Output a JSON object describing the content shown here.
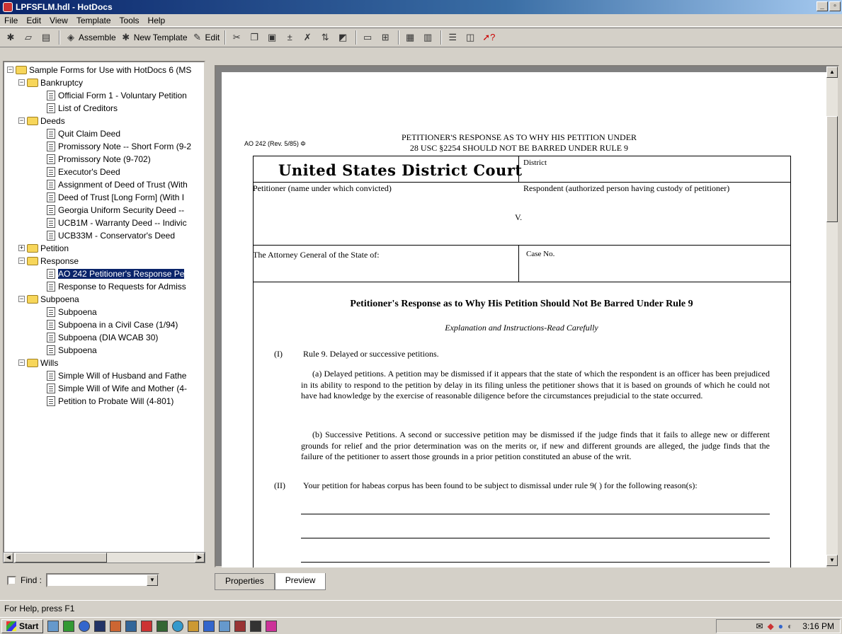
{
  "window": {
    "title": "LPFSFLM.hdl - HotDocs"
  },
  "menu": [
    "File",
    "Edit",
    "View",
    "Template",
    "Tools",
    "Help"
  ],
  "toolbar": {
    "assemble": "Assemble",
    "new_template": "New Template",
    "edit": "Edit"
  },
  "tree": {
    "root": "Sample Forms for Use with HotDocs 6 (MS",
    "bankruptcy": "Bankruptcy",
    "bk1": "Official Form 1 - Voluntary Petition",
    "bk2": "List of Creditors",
    "deeds": "Deeds",
    "d1": "Quit Claim Deed",
    "d2": "Promissory Note -- Short Form (9-2",
    "d3": "Promissory Note (9-702)",
    "d4": "Executor's Deed",
    "d5": "Assignment of Deed of Trust (With",
    "d6": "Deed of Trust [Long Form] (With I",
    "d7": "Georgia Uniform Security Deed --",
    "d8": "UCB1M - Warranty Deed -- Indivic",
    "d9": "UCB33M - Conservator's Deed",
    "petition": "Petition",
    "response": "Response",
    "r1": "AO 242 Petitioner's Response Pe",
    "r2": "Response to Requests for Admiss",
    "subpoena": "Subpoena",
    "s1": "Subpoena",
    "s2": "Subpoena in a Civil Case (1/94)",
    "s3": "Subpoena (DIA WCAB 30)",
    "s4": "Subpoena",
    "wills": "Wills",
    "w1": "Simple Will of Husband and Fathe",
    "w2": "Simple Will of Wife and Mother (4-",
    "w3": "Petition to Probate Will (4-801)"
  },
  "find": {
    "label": "Find :"
  },
  "tabs": {
    "properties": "Properties",
    "preview": "Preview"
  },
  "status": "For Help, press F1",
  "taskbar": {
    "start": "Start",
    "clock": "3:16 PM"
  },
  "doc": {
    "form_id": "AO 242 (Rev. 5/85)",
    "form_mark": "Φ",
    "header1": "PETITIONER'S RESPONSE AS TO WHY HIS PETITION UNDER",
    "header2": "28 USC §2254 SHOULD NOT BE BARRED UNDER RULE 9",
    "court": "United States District Court",
    "district": "District",
    "petitioner": "Petitioner (name under which convicted)",
    "respondent": "Respondent (authorized person having custody of petitioner)",
    "v": "V.",
    "attorney": "The Attorney General of the State of:",
    "case_no": "Case No.",
    "title": "Petitioner's Response as to Why His Petition Should Not Be Barred Under Rule 9",
    "subtitle": "Explanation and Instructions-Read Carefully",
    "i_num": "(I)",
    "i_text": "Rule 9. Delayed or successive petitions.",
    "para_a": "(a) Delayed petitions. A petition may be dismissed if it appears that the state of which the respondent is an officer has been prejudiced in its ability to respond to the petition by delay in its filing unless the petitioner shows that it is based on grounds of which he could not have had knowledge by the exercise of reasonable diligence before the circumstances prejudicial to the state occurred.",
    "para_b": "(b) Successive Petitions. A second or successive petition may be dismissed if the judge finds that it fails to allege new or different grounds for relief and the prior determination was on the merits or, if new and different grounds are alleged, the judge finds that the failure of the petitioner to assert those grounds in a prior petition constituted an abuse of the writ.",
    "ii_num": "(II)",
    "ii_text": "Your petition for habeas corpus has been found to be subject to dismissal under rule 9(   ) for the following reason(s):"
  }
}
